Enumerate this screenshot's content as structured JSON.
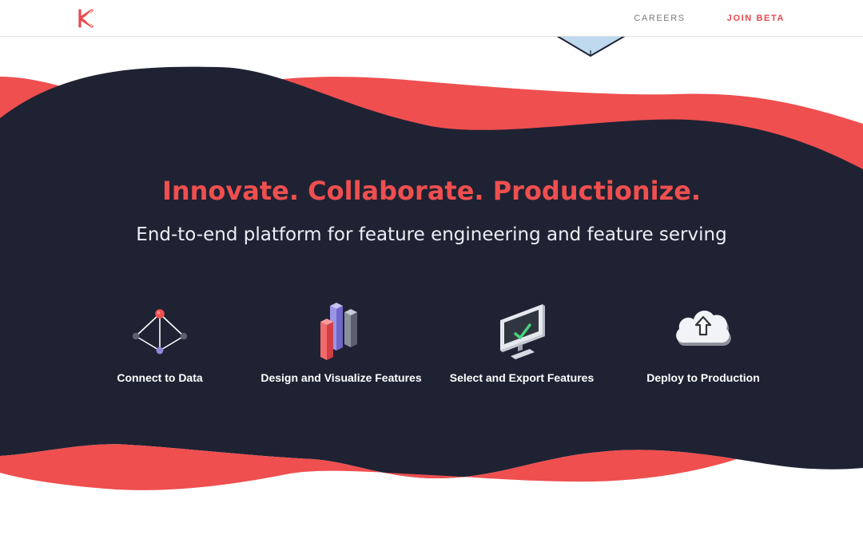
{
  "header": {
    "logo_icon": "brand-logo-icon",
    "nav": {
      "careers": "CAREERS",
      "join_beta": "JOIN BETA"
    }
  },
  "hero": {
    "title": "Innovate. Collaborate. Productionize.",
    "subtitle": "End-to-end platform for feature engineering and feature serving"
  },
  "features": [
    {
      "label": "Connect to Data",
      "icon": "network-graph-icon"
    },
    {
      "label": "Design and Visualize Features",
      "icon": "bar-chart-icon"
    },
    {
      "label": "Select and Export Features",
      "icon": "monitor-check-icon"
    },
    {
      "label": "Deploy to Production",
      "icon": "cloud-upload-icon"
    }
  ],
  "colors": {
    "accent": "#e9484d",
    "dark_band": "#1f2233",
    "wave_red": "#ef4f4f",
    "muted_nav": "#7a7a80",
    "light_text": "#eceef4"
  }
}
